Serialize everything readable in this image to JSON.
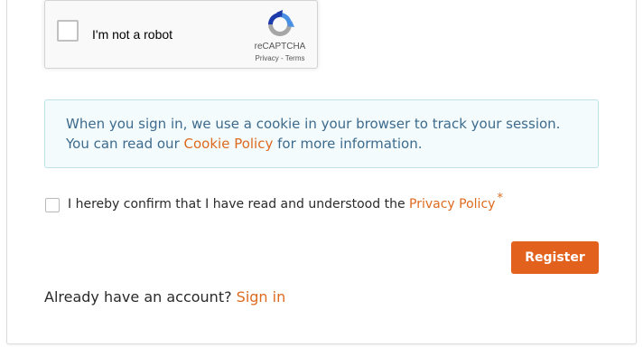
{
  "recaptcha": {
    "label": "I'm not a robot",
    "brand": "reCAPTCHA",
    "privacy_link": "Privacy",
    "separator": " - ",
    "terms_link": "Terms"
  },
  "info": {
    "text_before": "When you sign in, we use a cookie in your browser to track your session. You can read our ",
    "cookie_link": "Cookie Policy",
    "text_after": " for more information."
  },
  "consent": {
    "text": "I hereby confirm that I have read and understood the ",
    "privacy_link": "Privacy Policy",
    "required_marker": "*",
    "checked": false
  },
  "register_button": "Register",
  "signin": {
    "prompt": "Already have an account? ",
    "link": "Sign in"
  },
  "colors": {
    "accent": "#e2621d",
    "info_text": "#3e6b8d",
    "info_bg": "#f3fbfc"
  }
}
